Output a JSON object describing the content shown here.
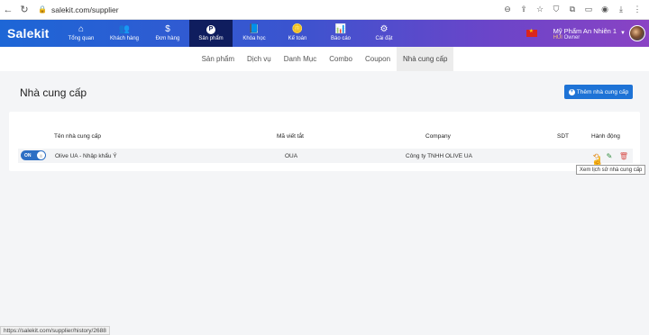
{
  "browser": {
    "url": "salekit.com/supplier"
  },
  "app": {
    "logo": "Salekit",
    "nav": [
      {
        "label": "Tổng quan",
        "icon": "home-icon",
        "glyph": "⌂"
      },
      {
        "label": "Khách hàng",
        "icon": "users-icon",
        "glyph": "👥"
      },
      {
        "label": "Đơn hàng",
        "icon": "dollar-icon",
        "glyph": "$"
      },
      {
        "label": "Sản phẩm",
        "icon": "product-p-icon",
        "glyph": "P"
      },
      {
        "label": "Khóa học",
        "icon": "book-icon",
        "glyph": "📘"
      },
      {
        "label": "Kế toán",
        "icon": "coins-icon",
        "glyph": "🪙"
      },
      {
        "label": "Báo cáo",
        "icon": "chart-icon",
        "glyph": "📊"
      },
      {
        "label": "Cài đặt",
        "icon": "gear-icon",
        "glyph": "⚙"
      }
    ],
    "active_nav": 3,
    "user": {
      "name": "Mỹ Phẩm An Nhiên 1",
      "role_badge": "HUI",
      "role": "Owner"
    }
  },
  "subtabs": [
    "Sản phẩm",
    "Dịch vụ",
    "Danh Mục",
    "Combo",
    "Coupon",
    "Nhà cung cấp"
  ],
  "active_subtab": 5,
  "page": {
    "title": "Nhà cung cấp",
    "add_button": "Thêm nhà cung cấp"
  },
  "table": {
    "headers": {
      "name": "Tên nhà cung cấp",
      "abbr": "Mã viết tắt",
      "company": "Company",
      "phone": "SDT",
      "actions": "Hành động"
    },
    "rows": [
      {
        "toggle": "ON",
        "name": "Olive UA - Nhập khẩu Ý",
        "abbr": "OUA",
        "company": "Công ty TNHH OLIVE UA",
        "phone": ""
      }
    ]
  },
  "tooltip": "Xem lịch sử nhà cung cấp",
  "status_url": "https://salekit.com/supplier/history/2688"
}
